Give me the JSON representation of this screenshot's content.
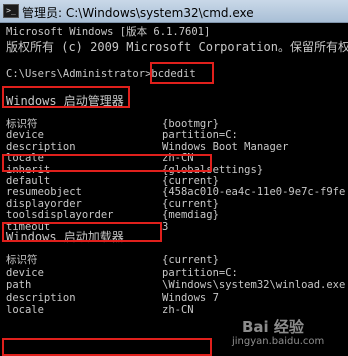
{
  "window": {
    "title": "管理员: C:\\Windows\\system32\\cmd.exe",
    "icon": "cmd-icon"
  },
  "console": {
    "header1": "Microsoft Windows [版本 6.1.7601]",
    "header2": "版权所有 (c) 2009 Microsoft Corporation。保留所有权",
    "prompt": "C:\\Users\\Administrator>",
    "command": "bcdedit",
    "section1_title": "Windows 启动管理器",
    "section1_rows": [
      {
        "key": "标识符",
        "value": "{bootmgr}"
      },
      {
        "key": "device",
        "value": "partition=C:"
      },
      {
        "key": "description",
        "value": "Windows Boot Manager"
      },
      {
        "key": "locale",
        "value": "zh-CN"
      },
      {
        "key": "inherit",
        "value": "{globalsettings}"
      },
      {
        "key": "default",
        "value": "{current}"
      },
      {
        "key": "resumeobject",
        "value": "{458ac010-ea4c-11e0-9e7c-f9fe"
      },
      {
        "key": "displayorder",
        "value": "{current}"
      },
      {
        "key": "toolsdisplayorder",
        "value": "{memdiag}"
      },
      {
        "key": "timeout",
        "value": "3"
      }
    ],
    "section2_title": "Windows 启动加载器",
    "section2_rows": [
      {
        "key": "标识符",
        "value": "{current}"
      },
      {
        "key": "device",
        "value": "partition=C:"
      },
      {
        "key": "path",
        "value": "\\Windows\\system32\\winload.exe"
      },
      {
        "key": "description",
        "value": "Windows 7"
      },
      {
        "key": "locale",
        "value": "zh-CN"
      }
    ]
  },
  "watermark": {
    "logo": "Bai 经验",
    "url": "jingyan.baidu.com"
  },
  "colors": {
    "console_bg": "#000000",
    "console_text": "#c8c8c8",
    "highlight_box": "#e0201c"
  }
}
